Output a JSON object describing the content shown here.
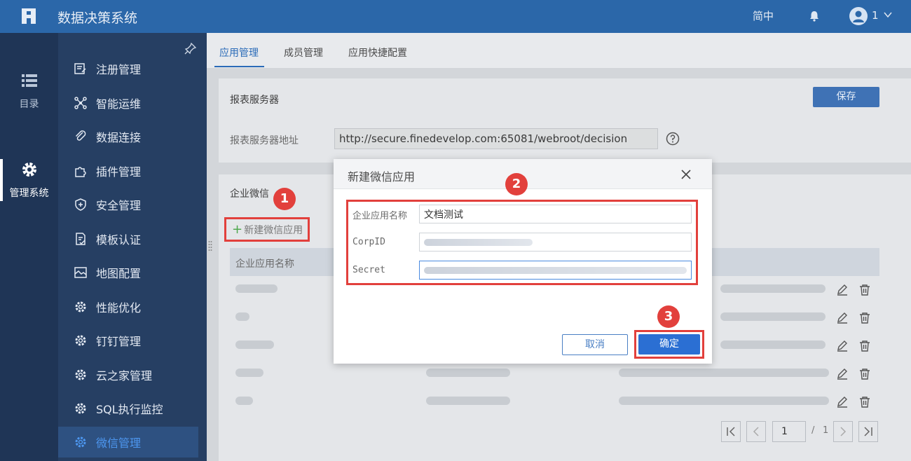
{
  "app": {
    "title": "数据决策系统"
  },
  "header": {
    "lang": "简中",
    "user": "1"
  },
  "rail": {
    "items": [
      {
        "label": "目录"
      },
      {
        "label": "管理系统"
      }
    ]
  },
  "nav": {
    "items": [
      {
        "label": "注册管理"
      },
      {
        "label": "智能运维"
      },
      {
        "label": "数据连接"
      },
      {
        "label": "插件管理"
      },
      {
        "label": "安全管理"
      },
      {
        "label": "模板认证"
      },
      {
        "label": "地图配置"
      },
      {
        "label": "性能优化"
      },
      {
        "label": "钉钉管理"
      },
      {
        "label": "云之家管理"
      },
      {
        "label": "SQL执行监控"
      },
      {
        "label": "微信管理"
      }
    ],
    "active": "微信管理"
  },
  "tabs": [
    {
      "label": "应用管理"
    },
    {
      "label": "成员管理"
    },
    {
      "label": "应用快捷配置"
    }
  ],
  "report_server": {
    "title": "报表服务器",
    "save_label": "保存",
    "address_label": "报表服务器地址",
    "address_value": "http://secure.finedevelop.com:65081/webroot/decision"
  },
  "wechat": {
    "title": "企业微信",
    "add_label": "新建微信应用",
    "columns": [
      {
        "label": "企业应用名称"
      }
    ]
  },
  "pager": {
    "current": "1",
    "separator": "/",
    "total": "1"
  },
  "modal": {
    "title": "新建微信应用",
    "fields": [
      {
        "label": "企业应用名称",
        "value": "文档测试"
      },
      {
        "label": "CorpID",
        "value": ""
      },
      {
        "label": "Secret",
        "value": ""
      }
    ],
    "cancel_label": "取消",
    "ok_label": "确定"
  },
  "badges": [
    "1",
    "2",
    "3"
  ],
  "colors": {
    "header": "#2b67a9",
    "accent": "#2b6fd3",
    "highlight": "#e2403c"
  }
}
